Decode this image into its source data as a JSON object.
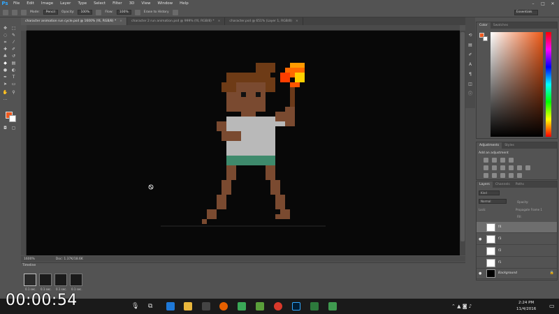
{
  "app": {
    "logo": "Ps",
    "menu": [
      "File",
      "Edit",
      "Image",
      "Layer",
      "Type",
      "Select",
      "Filter",
      "3D",
      "View",
      "Window",
      "Help"
    ]
  },
  "options": {
    "mode_label": "Mode:",
    "mode_value": "Pencil",
    "opacity_label": "Opacity:",
    "opacity_value": "100%",
    "flow_label": "Flow:",
    "flow_value": "100%",
    "erase_history": "Erase to History",
    "workspace": "Essentials"
  },
  "tabs": [
    {
      "label": "character animation run cycle.psd @ 1600% (f4, RGB/8) *",
      "active": true
    },
    {
      "label": "character 2 run animation.psd @ 999% (f4, RGB/8) *",
      "active": false
    },
    {
      "label": "character.psd @ 651% (Layer 1, RGB/8)",
      "active": false
    }
  ],
  "status": {
    "zoom": "1600%",
    "doc": "Doc: 1.37K/18.6K"
  },
  "timeline": {
    "title": "Timeline",
    "frames": [
      {
        "index": "1",
        "duration": "0.1 sec."
      },
      {
        "index": "2",
        "duration": "0.1 sec."
      },
      {
        "index": "3",
        "duration": "0.1 sec."
      },
      {
        "index": "4",
        "duration": "0.1 sec."
      }
    ]
  },
  "color_panel": {
    "tabs": [
      "Color",
      "Swatches"
    ],
    "foreground": "#ef5a1f",
    "background": "#ffffff"
  },
  "adjustments": {
    "tabs": [
      "Adjustments",
      "Styles"
    ],
    "label": "Add an adjustment"
  },
  "layers": {
    "tabs": [
      "Layers",
      "Channels",
      "Paths"
    ],
    "filter": "Kind",
    "blend": "Normal",
    "opacity": "Opacity:",
    "lock": "Lock:",
    "propagate": "Propagate Frame 1",
    "fill": "Fill:",
    "items": [
      {
        "name": "f4",
        "visible": false,
        "selected": true,
        "background": false
      },
      {
        "name": "f3",
        "visible": true,
        "selected": false,
        "background": false
      },
      {
        "name": "f2",
        "visible": false,
        "selected": false,
        "background": false
      },
      {
        "name": "f1",
        "visible": false,
        "selected": false,
        "background": false
      },
      {
        "name": "Background",
        "visible": true,
        "selected": false,
        "background": true
      }
    ]
  },
  "taskbar": {
    "time": "2:24 PM",
    "date": "11/4/2016"
  },
  "overlay": {
    "timer": "00:00:54"
  },
  "colors": {
    "skin": "#7a4a30",
    "hair": "#6e3b16",
    "shirt": "#b9b9b9",
    "shorts": "#3e8a6c",
    "flame": "#ff6a00",
    "accent": "#31a8ff"
  }
}
